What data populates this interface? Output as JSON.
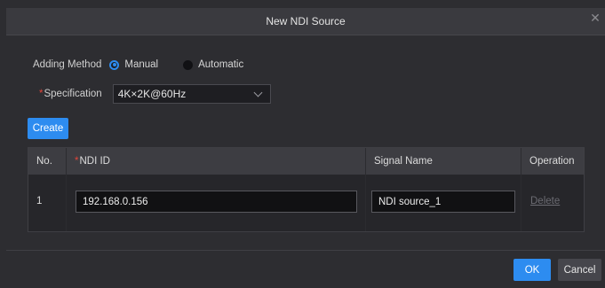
{
  "dialog": {
    "title": "New NDI Source",
    "close_icon": "close-icon"
  },
  "adding_method": {
    "label": "Adding Method",
    "options": [
      {
        "label": "Manual",
        "checked": true
      },
      {
        "label": "Automatic",
        "checked": false
      }
    ]
  },
  "specification": {
    "required_mark": "*",
    "label": "Specification",
    "value": "4K×2K@60Hz",
    "icon": "chevron-down-icon"
  },
  "create_label": "Create",
  "table": {
    "headers": {
      "no": "No.",
      "ndi_required": "*",
      "ndi_id": "NDI ID",
      "signal_name": "Signal Name",
      "operation": "Operation"
    },
    "rows": [
      {
        "no": "1",
        "ndi_id": "192.168.0.156",
        "signal_name": "NDI source_1",
        "operation": "Delete"
      }
    ]
  },
  "footer": {
    "ok_label": "OK",
    "cancel_label": "Cancel"
  },
  "colors": {
    "accent": "#2d8cf0",
    "required": "#e0453a",
    "background": "#2d2d31"
  }
}
